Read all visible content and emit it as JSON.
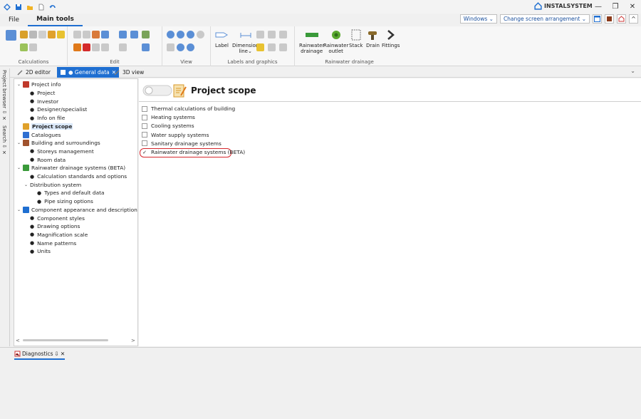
{
  "window": {
    "brand": "INSTALSYSTEM",
    "minimize": "—",
    "restore": "❐",
    "close": "✕"
  },
  "menu": {
    "file": "File",
    "main_tools": "Main tools"
  },
  "toprights": {
    "windows": "Windows ⌄",
    "arrangement": "Change screen arrangement ⌄",
    "up": "^"
  },
  "ribbon": {
    "calculations": "Calculations",
    "edit": "Edit",
    "view": "View",
    "labels_graphics": "Labels and graphics",
    "label_btn": "Label",
    "dimension_btn": "Dimension",
    "dimension_btn2": "line⌄",
    "rainwater_drainage_btn": "Rainwater",
    "rainwater_drainage_btn2": "drainage",
    "rainwater_outlet_btn": "Rainwater",
    "rainwater_outlet_btn2": "outlet",
    "stack_btn": "Stack",
    "drain_btn": "Drain",
    "fittings_btn": "Fittings",
    "rainwater_group": "Rainwater drainage"
  },
  "tabs": {
    "editor2d": "2D editor",
    "general": "● General data",
    "close": "✕",
    "view3d": "3D view",
    "chevron": "⌄"
  },
  "side": {
    "project_browser": "Project browser ⇩ ✕",
    "search": "Search ⇩ ✕"
  },
  "tree": {
    "items": [
      {
        "label": "Project info",
        "level": 0,
        "exp": "⌄",
        "icon": "book"
      },
      {
        "label": "Project",
        "level": 1,
        "exp": "",
        "icon": "dot"
      },
      {
        "label": "Investor",
        "level": 1,
        "exp": "",
        "icon": "dot"
      },
      {
        "label": "Designer/specialist",
        "level": 1,
        "exp": "",
        "icon": "dot"
      },
      {
        "label": "Info on file",
        "level": 1,
        "exp": "",
        "icon": "dot"
      },
      {
        "label": "Project scope",
        "level": 0,
        "exp": "",
        "icon": "scope",
        "sel": true
      },
      {
        "label": "Catalogues",
        "level": 0,
        "exp": "",
        "icon": "cat"
      },
      {
        "label": "Building and surroundings",
        "level": 0,
        "exp": "⌄",
        "icon": "building"
      },
      {
        "label": "Storeys management",
        "level": 1,
        "exp": "",
        "icon": "dot"
      },
      {
        "label": "Room data",
        "level": 1,
        "exp": "",
        "icon": "dot"
      },
      {
        "label": "Rainwater drainage systems (BETA)",
        "level": 0,
        "exp": "⌄",
        "icon": "drop"
      },
      {
        "label": "Calculation standards and options",
        "level": 1,
        "exp": "",
        "icon": "dot"
      },
      {
        "label": "Distribution system",
        "level": 1,
        "exp": "⌄",
        "icon": ""
      },
      {
        "label": "Types and default data",
        "level": 2,
        "exp": "",
        "icon": "dot"
      },
      {
        "label": "Pipe sizing options",
        "level": 2,
        "exp": "",
        "icon": "dot"
      },
      {
        "label": "Component appearance and descriptions config",
        "level": 0,
        "exp": "⌄",
        "icon": "comp"
      },
      {
        "label": "Component styles",
        "level": 1,
        "exp": "",
        "icon": "dot"
      },
      {
        "label": "Drawing options",
        "level": 1,
        "exp": "",
        "icon": "dot"
      },
      {
        "label": "Magnification scale",
        "level": 1,
        "exp": "",
        "icon": "dot"
      },
      {
        "label": "Name patterns",
        "level": 1,
        "exp": "",
        "icon": "dot"
      },
      {
        "label": "Units",
        "level": 1,
        "exp": "",
        "icon": "dot"
      }
    ],
    "scroll_left": "<",
    "scroll_right": ">"
  },
  "main": {
    "title": "Project scope",
    "checks": [
      {
        "label": "Thermal calculations of building",
        "checked": false
      },
      {
        "label": "Heating systems",
        "checked": false
      },
      {
        "label": "Cooling systems",
        "checked": false
      },
      {
        "label": "Water supply systems",
        "checked": false
      },
      {
        "label": "Sanitary drainage systems",
        "checked": false
      },
      {
        "label": "Rainwater drainage systems (BETA)",
        "checked": true
      }
    ]
  },
  "status": {
    "diagnostics": "Diagnostics",
    "pin": "⇩",
    "close": "✕"
  }
}
